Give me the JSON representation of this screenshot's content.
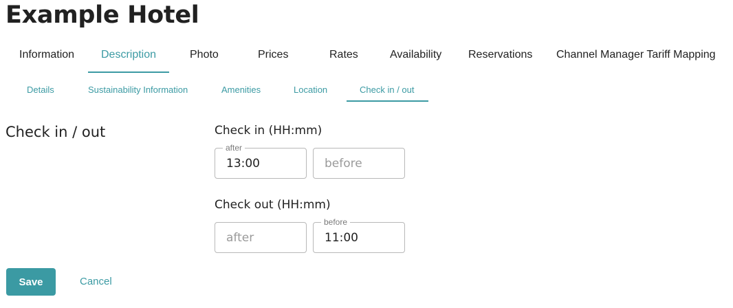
{
  "page_title": "Example Hotel",
  "tabs": [
    {
      "label": "Information"
    },
    {
      "label": "Description",
      "active": true
    },
    {
      "label": "Photo"
    },
    {
      "label": "Prices"
    },
    {
      "label": "Rates"
    },
    {
      "label": "Availability"
    },
    {
      "label": "Reservations"
    },
    {
      "label": "Channel Manager Tariff Mapping"
    }
  ],
  "subtabs": [
    {
      "label": "Details"
    },
    {
      "label": "Sustainability Information"
    },
    {
      "label": "Amenities"
    },
    {
      "label": "Location"
    },
    {
      "label": "Check in / out",
      "active": true
    }
  ],
  "section": {
    "heading": "Check in / out",
    "check_in": {
      "label": "Check in (HH:mm)",
      "after": {
        "label": "after",
        "value": "13:00",
        "placeholder": "after"
      },
      "before": {
        "label": "before",
        "value": "",
        "placeholder": "before"
      }
    },
    "check_out": {
      "label": "Check out (HH:mm)",
      "after": {
        "label": "after",
        "value": "",
        "placeholder": "after"
      },
      "before": {
        "label": "before",
        "value": "11:00",
        "placeholder": "before"
      }
    }
  },
  "actions": {
    "save_label": "Save",
    "cancel_label": "Cancel"
  },
  "colors": {
    "accent": "#3b9aa3",
    "text": "#212121",
    "border": "#b8b8b8"
  }
}
